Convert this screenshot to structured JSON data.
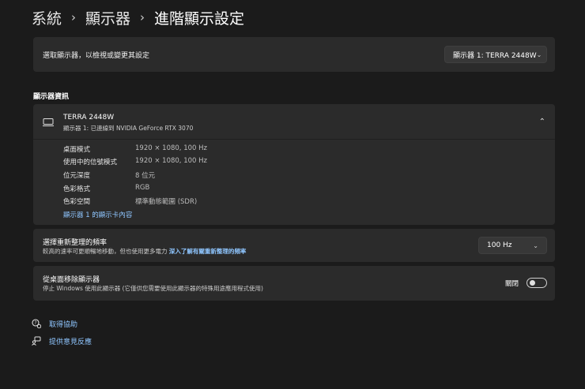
{
  "breadcrumb": {
    "items": [
      "系統",
      "顯示器",
      "進階顯示設定"
    ],
    "separator": "›"
  },
  "select_display": {
    "label": "選取顯示器，以檢視或變更其設定",
    "value": "顯示器 1: TERRA 2448W",
    "chevron_icon": "chevron-down-icon"
  },
  "display_info": {
    "section_title": "顯示器資訊",
    "name": "TERRA 2448W",
    "subtitle": "顯示器 1: 已連線到 NVIDIA GeForce RTX 3070",
    "monitor_icon": "monitor-icon",
    "collapse_icon": "chevron-up-icon",
    "rows": [
      {
        "key": "桌面模式",
        "value": "1920 × 1080, 100 Hz"
      },
      {
        "key": "使用中的信號模式",
        "value": "1920 × 1080, 100 Hz"
      },
      {
        "key": "位元深度",
        "value": "8 位元"
      },
      {
        "key": "色彩格式",
        "value": "RGB"
      },
      {
        "key": "色彩空間",
        "value": "標準動態範圍 (SDR)"
      }
    ],
    "adapter_link": "顯示器 1 的顯示卡內容"
  },
  "refresh_rate": {
    "title": "選擇重新整理的頻率",
    "description": "較高的速率可更順暢地移動，但也使用更多電力",
    "link": "深入了解有關重新整理的頻率",
    "value": "100 Hz"
  },
  "remove_display": {
    "title": "從桌面移除顯示器",
    "description": "停止 Windows 使用此顯示器 (它僅供您需要使用此顯示器的特殊用途應用程式使用)",
    "toggle_label": "關閉",
    "toggle_on": false
  },
  "footer": {
    "help": "取得協助",
    "feedback": "提供意見反應",
    "help_icon": "help-chat-icon",
    "feedback_icon": "feedback-icon"
  },
  "colors": {
    "background": "#1b1b1b",
    "card": "#2b2b2b",
    "link": "#8fc6ff"
  }
}
